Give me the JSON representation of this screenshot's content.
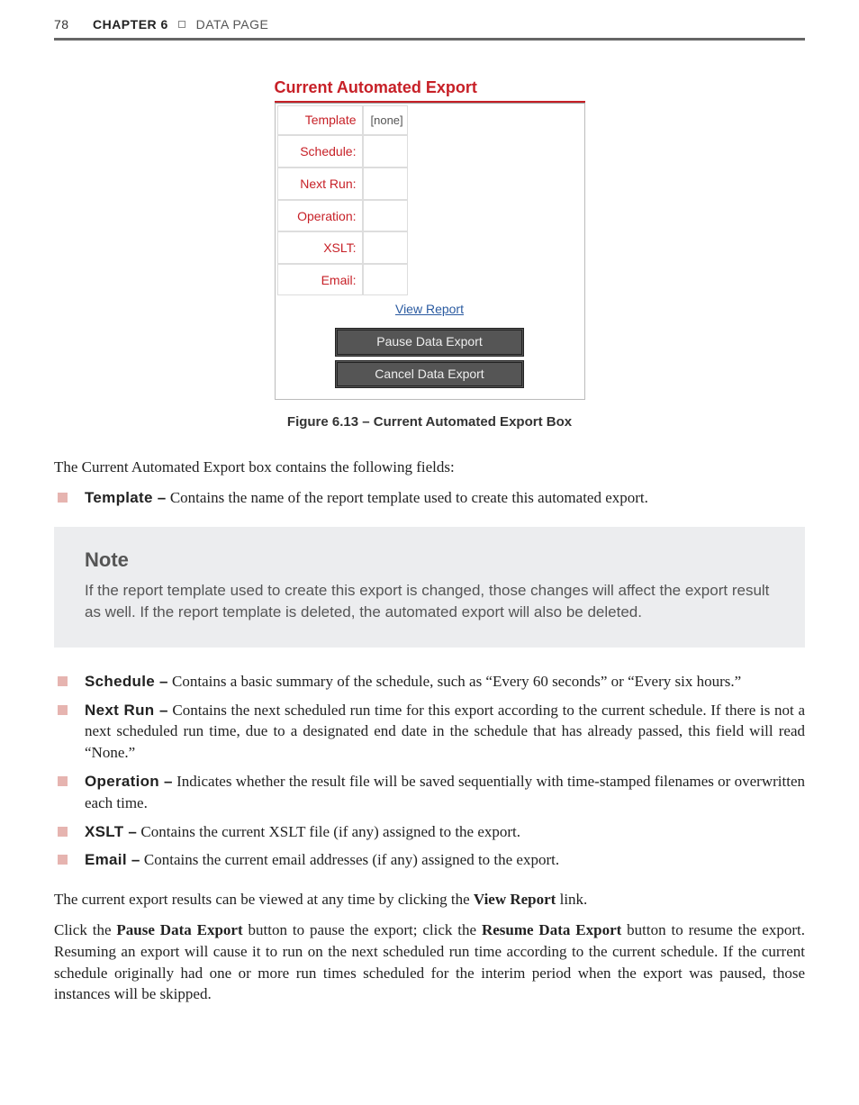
{
  "header": {
    "page_number": "78",
    "chapter_label": "CHAPTER 6",
    "chapter_title": "DATA PAGE"
  },
  "screenshot": {
    "title": "Current Automated Export",
    "rows": {
      "template_label": "Template",
      "template_value": "[none]",
      "schedule_label": "Schedule:",
      "schedule_value": "",
      "nextrun_label": "Next Run:",
      "nextrun_value": "",
      "operation_label": "Operation:",
      "operation_value": "",
      "xslt_label": "XSLT:",
      "xslt_value": "",
      "email_label": "Email:",
      "email_value": ""
    },
    "view_report_label": "View Report",
    "pause_button_label": "Pause Data Export",
    "cancel_button_label": "Cancel Data Export"
  },
  "figure_caption": "Figure 6.13 – Current Automated Export Box",
  "intro_para": "The Current Automated Export box contains the following fields:",
  "list1": [
    {
      "label": "Template –",
      "text": " Contains the name of the report template used to create this automated export."
    }
  ],
  "note": {
    "title": "Note",
    "body": "If the report template used to create this export is changed, those changes will affect the export result as well. If the report template is deleted, the automated export will also be deleted."
  },
  "list2": [
    {
      "label": "Schedule –",
      "text": " Contains a basic summary of the schedule, such as “Every 60 seconds” or “Every six hours.”"
    },
    {
      "label": "Next Run –",
      "text": " Contains the next scheduled run time for this export according to the current schedule. If there is not a next scheduled run time, due to a designated end date in the schedule that has already passed, this field will read “None.”"
    },
    {
      "label": "Operation –",
      "text": " Indicates whether the result file will be saved sequentially with time-stamped filenames or overwritten each time."
    },
    {
      "label": "XSLT –",
      "text": " Contains the current XSLT file (if any) assigned to the export."
    },
    {
      "label": "Email –",
      "text": " Contains the current email addresses (if any) assigned to the export."
    }
  ],
  "para_view": {
    "prefix": "The current export results can be viewed at any time by clicking the ",
    "bold": "View Report",
    "suffix": " link."
  },
  "para_pause": {
    "t0": "Click the ",
    "b0": "Pause Data Export",
    "t1": " button to pause the export; click the ",
    "b1": "Resume Data Export",
    "t2": " button to resume the export. Resuming an export will cause it to run on the next scheduled run time according to the current schedule. If the current schedule originally had one or more run times scheduled for the interim period when the export was paused, those instances will be skipped."
  }
}
